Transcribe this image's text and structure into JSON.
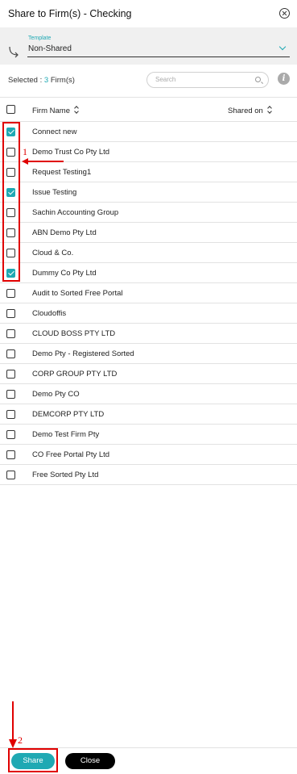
{
  "header": {
    "title": "Share to Firm(s) - Checking",
    "close_icon": "close-circle-icon"
  },
  "template": {
    "label": "Template",
    "value": "Non-Shared"
  },
  "selection": {
    "prefix": "Selected : ",
    "count": "3",
    "suffix": " Firm(s)"
  },
  "search": {
    "placeholder": "Search"
  },
  "table": {
    "columns": {
      "name": "Firm Name",
      "shared": "Shared on"
    },
    "rows": [
      {
        "name": "Connect new",
        "checked": true
      },
      {
        "name": "Demo Trust Co Pty Ltd",
        "checked": false
      },
      {
        "name": "Request Testing1",
        "checked": false
      },
      {
        "name": "Issue Testing",
        "checked": true
      },
      {
        "name": "Sachin Accounting Group",
        "checked": false
      },
      {
        "name": "ABN Demo Pty Ltd",
        "checked": false
      },
      {
        "name": "Cloud & Co.",
        "checked": false
      },
      {
        "name": "Dummy Co Pty Ltd",
        "checked": true
      },
      {
        "name": "Audit to Sorted Free Portal",
        "checked": false
      },
      {
        "name": "Cloudoffis",
        "checked": false
      },
      {
        "name": "CLOUD BOSS PTY LTD",
        "checked": false
      },
      {
        "name": "Demo Pty - Registered Sorted",
        "checked": false
      },
      {
        "name": "CORP GROUP PTY LTD",
        "checked": false
      },
      {
        "name": "Demo Pty CO",
        "checked": false
      },
      {
        "name": "DEMCORP PTY LTD",
        "checked": false
      },
      {
        "name": "Demo Test Firm Pty",
        "checked": false
      },
      {
        "name": "CO Free Portal Pty Ltd",
        "checked": false
      },
      {
        "name": "Free Sorted Pty Ltd",
        "checked": false
      }
    ]
  },
  "footer": {
    "share_label": "Share",
    "close_label": "Close"
  },
  "annotations": {
    "first": "1",
    "second": "2"
  },
  "colors": {
    "accent": "#1fa9b3",
    "annotation": "#e00000"
  }
}
